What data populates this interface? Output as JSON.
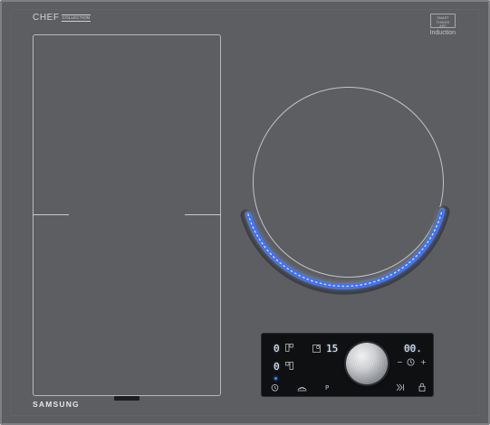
{
  "brand": {
    "series": "CHEF",
    "series_sub": "COLLECTION",
    "manufacturer": "SAMSUNG",
    "badge_lines": [
      "SMART",
      "THINGS",
      "APP"
    ],
    "induction_label": "Induction"
  },
  "colors": {
    "glass": "#5c5e61",
    "frame": "#7d7f82",
    "zone_outline": "#b7b8bb",
    "flame_blue": "#3a6fff",
    "flame_glow": "#86aaff",
    "display_text": "#e9f2ff",
    "panel": "#0f1012"
  },
  "cooktop": {
    "flex_zone_label": "",
    "round_zone_active": true
  },
  "control_panel": {
    "zone1_power": "0",
    "zone2_power": "0",
    "round_zone_value": "15",
    "timer_value": "00.",
    "minus_label": "−",
    "plus_label": "+",
    "pause_label": "P",
    "icons": [
      "timer-icon",
      "warm-icon",
      "pause-icon",
      "boost-icon",
      "lock-icon",
      "clock-icon",
      "flex-zone-icon",
      "round-zone-icon"
    ]
  }
}
